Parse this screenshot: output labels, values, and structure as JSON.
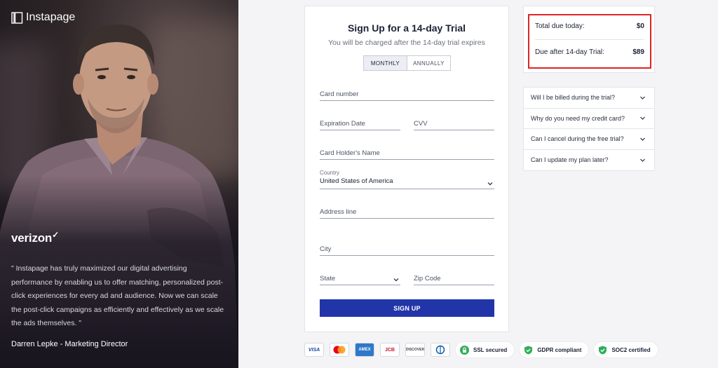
{
  "brand": {
    "name": "Instapage"
  },
  "testimonial": {
    "company": "verizon",
    "quote": "\" Instapage has truly maximized our digital advertising performance by enabling us to offer matching, personalized post-click experiences for every ad and audience. Now we can scale the post-click campaigns as efficiently and effectively as we scale the ads themselves. \"",
    "author": "Darren Lepke - Marketing Director"
  },
  "form": {
    "title": "Sign Up for a 14-day Trial",
    "subtitle": "You will be charged after the 14-day trial expires",
    "billing_toggle": {
      "monthly": "MONTHLY",
      "annually": "ANNUALLY",
      "selected": "MONTHLY"
    },
    "card_number": "Card number",
    "expiration_date": "Expiration Date",
    "cvv": "CVV",
    "card_holder": "Card Holder's Name",
    "country_label": "Country",
    "country_value": "United States of America",
    "address": "Address line",
    "city": "City",
    "state": "State",
    "zip": "Zip Code",
    "submit": "SIGN UP"
  },
  "totals": {
    "today_label": "Total due today:",
    "today_value": "$0",
    "after_label": "Due after 14-day Trial:",
    "after_value": "$89"
  },
  "faq": [
    "Will I be billed during the trial?",
    "Why do you need my credit card?",
    "Can I cancel during the free trial?",
    "Can I update my plan later?"
  ],
  "payment_cards": [
    "VISA",
    "MASTERCARD",
    "AMEX",
    "JCB",
    "DISCOVER",
    "DINERS"
  ],
  "trust_badges": {
    "ssl": "SSL secured",
    "gdpr": "GDPR compliant",
    "soc2": "SOC2 certified"
  },
  "colors": {
    "primary": "#2235a8",
    "highlight": "#e02424",
    "trust_green": "#2fae5a"
  }
}
